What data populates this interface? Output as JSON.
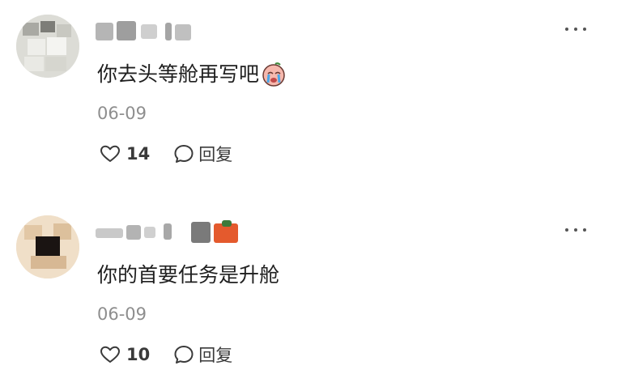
{
  "comments": [
    {
      "text": "你去头等舱再写吧",
      "emoji_icon": "crying-face-emoji",
      "date": "06-09",
      "likes": "14",
      "reply_label": "回复"
    },
    {
      "text": "你的首要任务是升舱",
      "date": "06-09",
      "likes": "10",
      "reply_label": "回复"
    }
  ],
  "icons": {
    "like": "heart-outline-icon",
    "reply": "speech-bubble-icon",
    "more": "more-dots-icon"
  },
  "colors": {
    "text": "#1f1f1f",
    "meta": "#8e8e8e",
    "action": "#3a3a3a"
  }
}
